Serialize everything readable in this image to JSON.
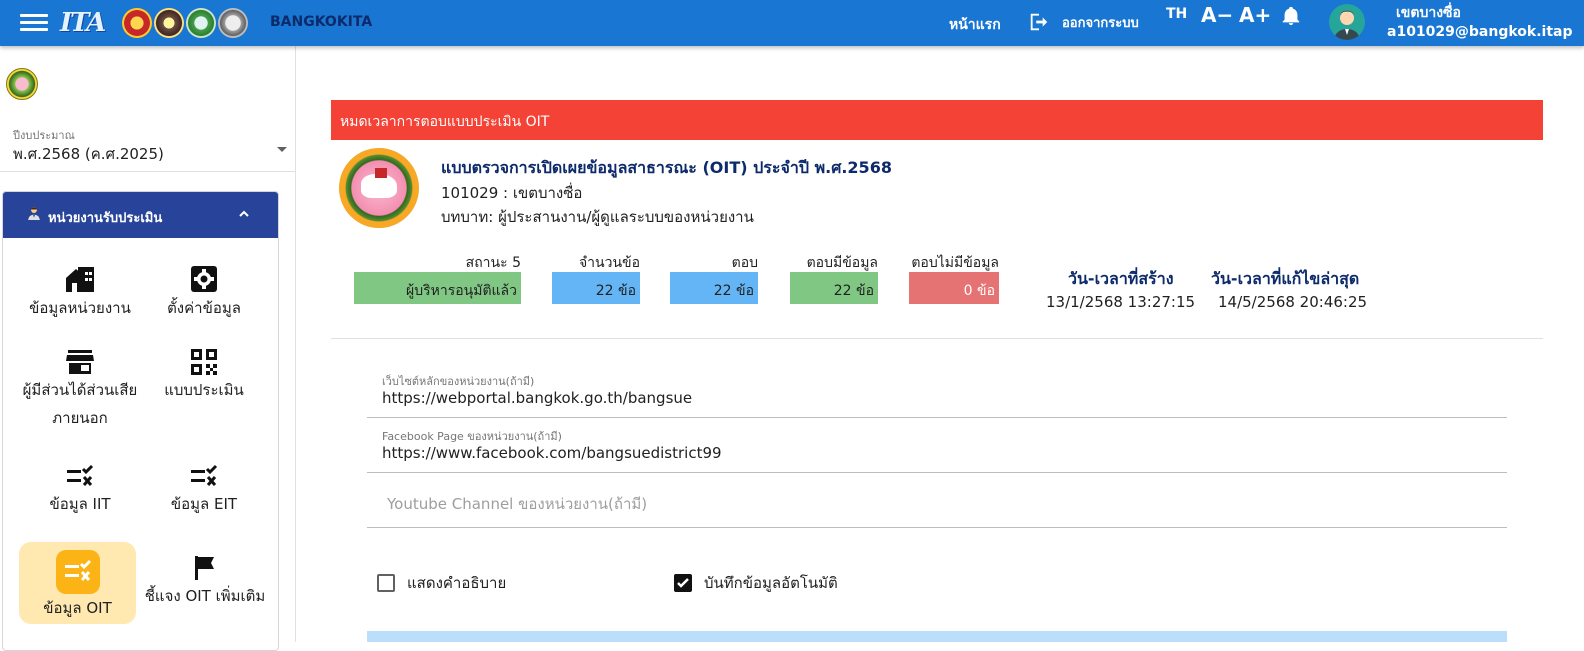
{
  "header": {
    "logo_text": "ITA",
    "brand": "BANGKOKITA",
    "home_label": "หน้าแรก",
    "logout_label": "ออกจากระบบ",
    "language": "TH",
    "font_decrease": "A−",
    "font_increase": "A+",
    "user_name": "เขตบางซื่อ",
    "user_email": "a101029@bangkok.itap",
    "accent_color": "#1976d2"
  },
  "sidebar": {
    "fiscal_year_label": "ปีงบประมาณ",
    "fiscal_year_value": "พ.ศ.2568 (ค.ศ.2025)",
    "panel_title": "หน่วยงานรับประเมิน",
    "panel_color": "#27449a",
    "tiles": [
      {
        "label": "ข้อมูลหน่วยงาน",
        "icon": "building-icon"
      },
      {
        "label": "ตั้งค่าข้อมูล",
        "icon": "gear-icon"
      },
      {
        "label": "ผู้มีส่วนได้ส่วนเสีย",
        "label2": "ภายนอก",
        "icon": "store-icon"
      },
      {
        "label": "แบบประเมิน",
        "icon": "qr-code-icon"
      },
      {
        "label": "ข้อมูล IIT",
        "icon": "checklist-icon"
      },
      {
        "label": "ข้อมูล EIT",
        "icon": "checklist-icon"
      },
      {
        "label": "ข้อมูล OIT",
        "icon": "checklist-icon",
        "active": true
      },
      {
        "label": "ชี้แจง OIT เพิ่มเติม",
        "icon": "flag-icon"
      }
    ]
  },
  "main": {
    "alert": "หมดเวลาการตอบแบบประเมิน OIT",
    "title": "แบบตรวจการเปิดเผยข้อมูลสาธารณะ (OIT) ประจำปี พ.ศ.2568",
    "org": "101029 : เขตบางซื่อ",
    "role": "บทบาท: ผู้ประสานงาน/ผู้ดูแลระบบของหน่วยงาน",
    "stats": [
      {
        "label": "สถานะ 5",
        "value": "ผู้บริหารอนุมัติแล้ว",
        "color": "#81c784"
      },
      {
        "label": "จำนวนข้อ",
        "value": "22 ข้อ",
        "color": "#64b5f6"
      },
      {
        "label": "ตอบ",
        "value": "22 ข้อ",
        "color": "#64b5f6"
      },
      {
        "label": "ตอบมีข้อมูล",
        "value": "22 ข้อ",
        "color": "#81c784"
      },
      {
        "label": "ตอบไม่มีข้อมูล",
        "value": "0 ข้อ",
        "color": "#e57373"
      }
    ],
    "created_label": "วัน-เวลาที่สร้าง",
    "created_value": "13/1/2568 13:27:15",
    "updated_label": "วัน-เวลาที่แก้ไขล่าสุด",
    "updated_value": "14/5/2568 20:46:25",
    "fields": {
      "website_label": "เว็บไซต์หลักของหน่วยงาน(ถ้ามี)",
      "website_value": "https://webportal.bangkok.go.th/bangsue",
      "facebook_label": "Facebook Page ของหน่วยงาน(ถ้ามี)",
      "facebook_value": "https://www.facebook.com/bangsuedistrict99",
      "youtube_placeholder": "Youtube Channel ของหน่วยงาน(ถ้ามี)"
    },
    "checkbox_show_desc": "แสดงคำอธิบาย",
    "checkbox_show_desc_checked": false,
    "checkbox_autosave": "บันทึกข้อมูลอัตโนมัติ",
    "checkbox_autosave_checked": true
  }
}
